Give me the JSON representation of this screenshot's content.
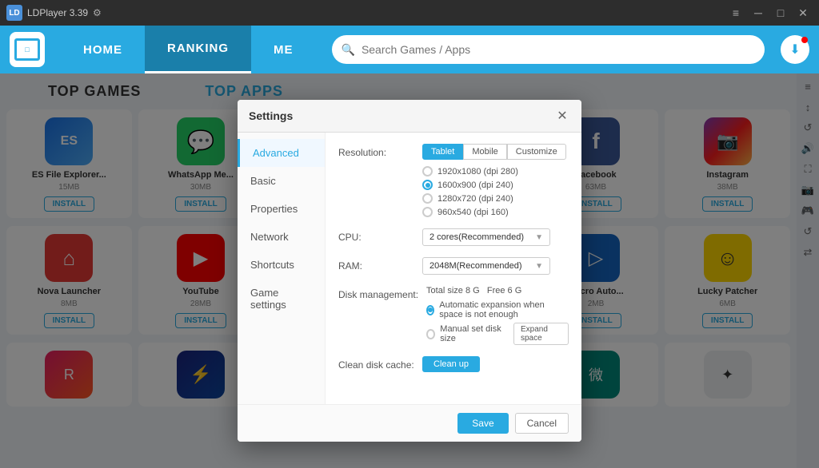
{
  "app": {
    "title": "LDPlayer 3.39",
    "version": "3.39"
  },
  "titlebar": {
    "title": "LDPlayer 3.39",
    "menu_icon": "≡",
    "minimize_icon": "─",
    "maximize_icon": "□",
    "close_icon": "✕"
  },
  "navbar": {
    "home_label": "HOME",
    "ranking_label": "RANKING",
    "me_label": "ME",
    "search_placeholder": "Search Games / Apps"
  },
  "sections": {
    "top_games": "TOP GAMES",
    "top_apps": "TOP APPS"
  },
  "apps": [
    {
      "name": "ES File Explorer...",
      "size": "15MB",
      "icon_label": "ES",
      "install": "INSTALL"
    },
    {
      "name": "WhatsApp Me...",
      "size": "30MB",
      "icon_label": "W",
      "install": "INSTALL"
    },
    {
      "name": "Facebook",
      "size": "63MB",
      "icon_label": "f",
      "install": "INSTALL"
    },
    {
      "name": "Instagram",
      "size": "38MB",
      "icon_label": "📷",
      "install": "INSTALL"
    },
    {
      "name": "Nova Launcher",
      "size": "8MB",
      "icon_label": "⌂",
      "install": "INSTALL"
    },
    {
      "name": "YouTube",
      "size": "28MB",
      "icon_label": "▶",
      "install": "INSTALL"
    },
    {
      "name": "Macro Auto...",
      "size": "2MB",
      "icon_label": "▷",
      "install": "INSTALL"
    },
    {
      "name": "Lucky Patcher",
      "size": "6MB",
      "icon_label": "☺",
      "install": "INSTALL"
    }
  ],
  "settings": {
    "title": "Settings",
    "close_icon": "✕",
    "sidebar_items": [
      {
        "id": "advanced",
        "label": "Advanced",
        "active": true
      },
      {
        "id": "basic",
        "label": "Basic"
      },
      {
        "id": "properties",
        "label": "Properties"
      },
      {
        "id": "network",
        "label": "Network"
      },
      {
        "id": "shortcuts",
        "label": "Shortcuts"
      },
      {
        "id": "game_settings",
        "label": "Game settings"
      }
    ],
    "resolution_label": "Resolution:",
    "resolution_tabs": [
      "Tablet",
      "Mobile",
      "Customize"
    ],
    "active_resolution_tab": "Tablet",
    "resolution_options": [
      {
        "value": "1920x1080 (dpi 280)",
        "selected": false
      },
      {
        "value": "1600x900 (dpi 240)",
        "selected": true
      },
      {
        "value": "1280x720 (dpi 240)",
        "selected": false
      },
      {
        "value": "960x540 (dpi 160)",
        "selected": false
      }
    ],
    "cpu_label": "CPU:",
    "cpu_value": "2 cores(Recommended)",
    "ram_label": "RAM:",
    "ram_value": "2048M(Recommended)",
    "disk_label": "Disk management:",
    "disk_total": "Total size 8 G",
    "disk_free": "Free 6 G",
    "disk_option1": "Automatic expansion when space is not enough",
    "disk_option2": "Manual set disk size",
    "expand_btn": "Expand space",
    "clean_label": "Clean disk cache:",
    "clean_btn": "Clean up",
    "save_btn": "Save",
    "cancel_btn": "Cancel"
  }
}
